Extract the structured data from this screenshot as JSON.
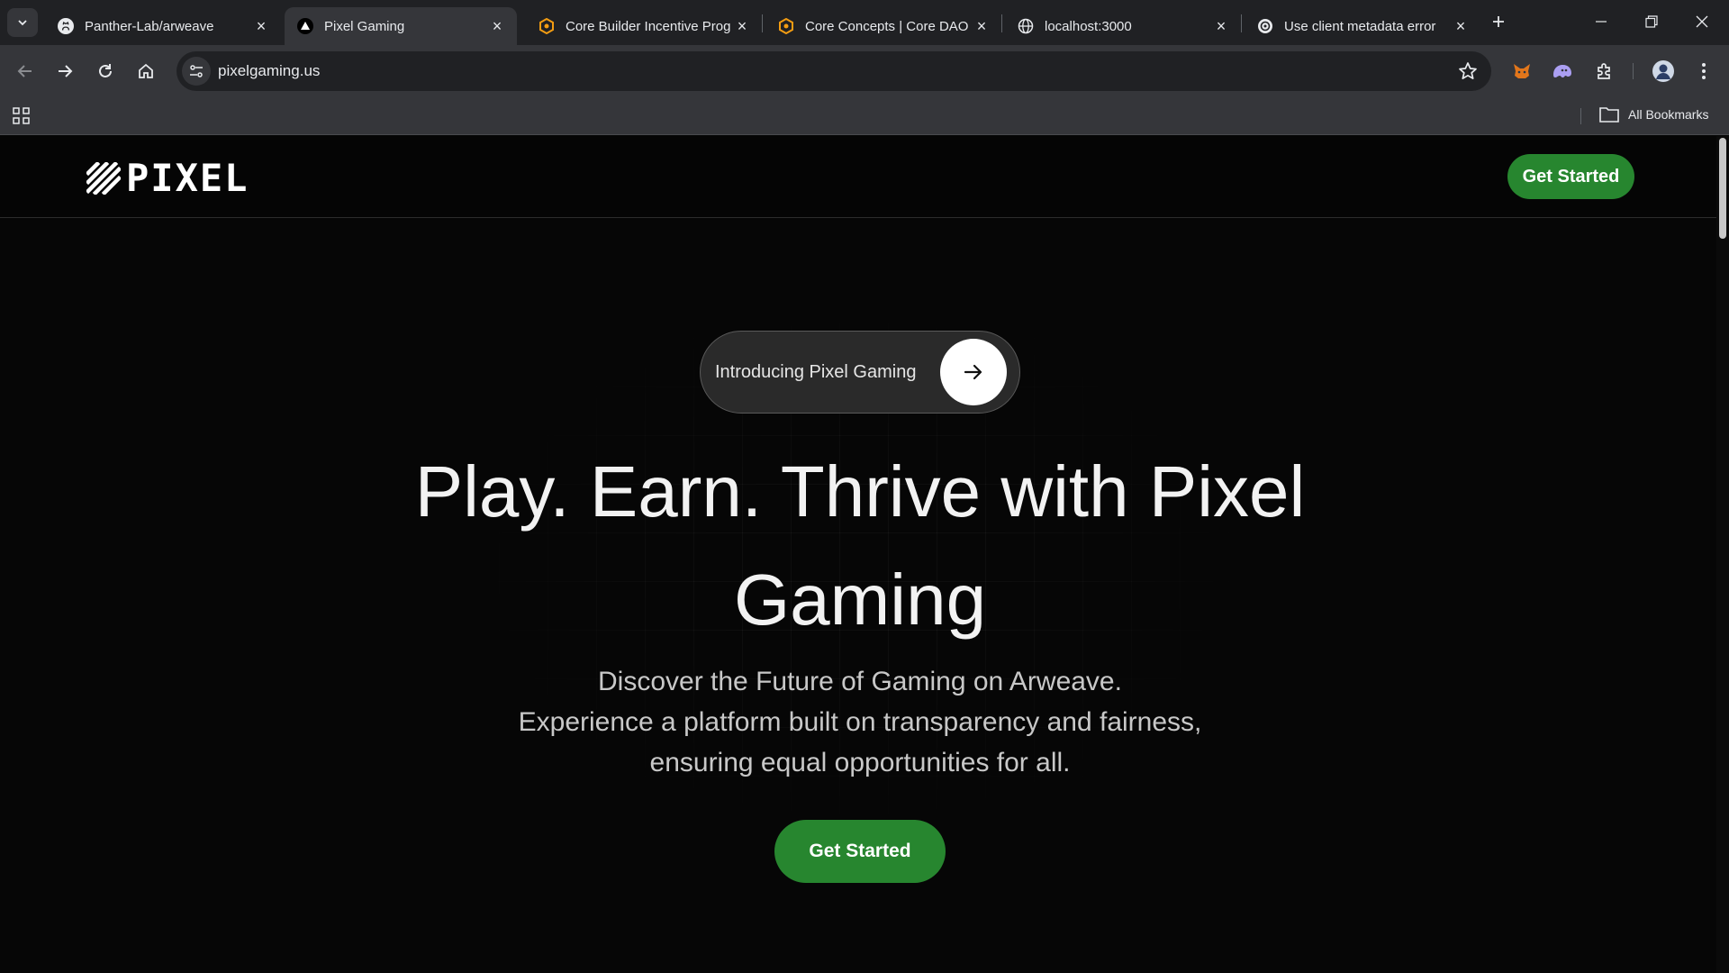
{
  "browser": {
    "tabs": [
      {
        "title": "Panther-Lab/arweave",
        "icon": "github-icon"
      },
      {
        "title": "Pixel Gaming",
        "icon": "triangle-icon"
      },
      {
        "title": "Core Builder Incentive Prog",
        "icon": "hexagon-icon"
      },
      {
        "title": "Core Concepts | Core DAO",
        "icon": "hexagon-icon"
      },
      {
        "title": "localhost:3000",
        "icon": "globe-icon"
      },
      {
        "title": "Use client metadata error",
        "icon": "openai-icon"
      }
    ],
    "active_tab": "Pixel Gaming",
    "url": "pixelgaming.us",
    "bookmarks_label": "All Bookmarks"
  },
  "nav": {
    "logo_text": "PIXEL",
    "cta_label": "Get Started"
  },
  "hero": {
    "pill_label": "Introducing Pixel Gaming",
    "headline": "Play. Earn. Thrive with Pixel Gaming",
    "subtitle_lines": [
      "Discover the Future of Gaming on Arweave.",
      "Experience a platform built on transparency and fairness,",
      "ensuring equal opportunities for all."
    ],
    "cta_label": "Get Started"
  },
  "colors": {
    "accent_green": "#27862f",
    "page_background": "#060606",
    "chrome_dark": "#202124",
    "chrome_mid": "#35363a"
  }
}
